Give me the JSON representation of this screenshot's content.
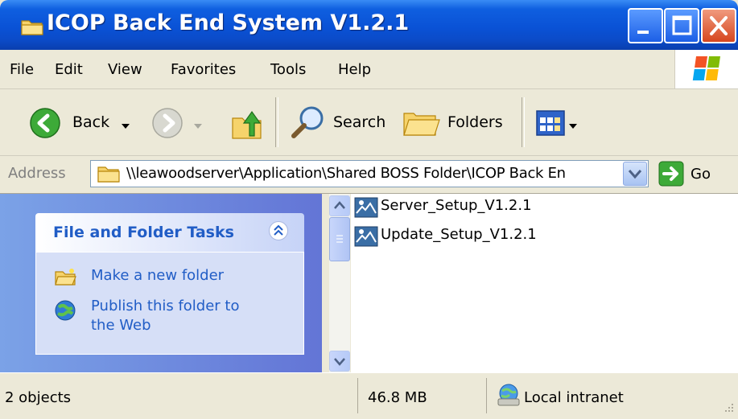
{
  "window": {
    "title": "ICOP Back End System V1.2.1"
  },
  "menu": {
    "items": [
      "File",
      "Edit",
      "View",
      "Favorites",
      "Tools",
      "Help"
    ]
  },
  "toolbar": {
    "back_label": "Back",
    "search_label": "Search",
    "folders_label": "Folders"
  },
  "address": {
    "label": "Address",
    "value": "\\\\leawoodserver\\Application\\Shared BOSS Folder\\ICOP Back En",
    "go_label": "Go"
  },
  "tasks": {
    "title": "File and Folder Tasks",
    "items": [
      {
        "label": "Make a new folder",
        "icon": "new-folder-icon"
      },
      {
        "label_line1": "Publish this folder to",
        "label_line2": "the Web",
        "icon": "publish-web-icon"
      }
    ]
  },
  "files": [
    {
      "name": "Server_Setup_V1.2.1",
      "icon": "setup-icon"
    },
    {
      "name": "Update_Setup_V1.2.1",
      "icon": "setup-icon"
    }
  ],
  "status": {
    "objects": "2 objects",
    "size": "46.8 MB",
    "zone": "Local intranet"
  },
  "colors": {
    "titlebar": "#0A52D6",
    "task_link": "#215DC6",
    "pane_gradient_start": "#7BA2E7",
    "pane_gradient_end": "#6375D6",
    "chrome": "#ECE9D8"
  }
}
